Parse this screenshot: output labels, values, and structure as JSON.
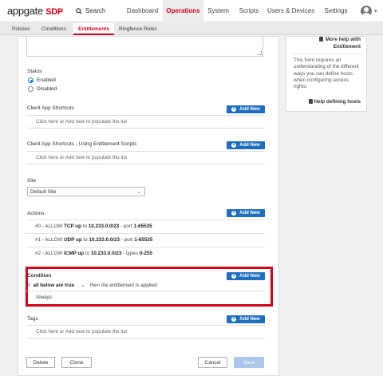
{
  "brand": {
    "part1": "appgate",
    "part2": "SDP"
  },
  "search": {
    "label": "Search"
  },
  "nav": [
    {
      "label": "Dashboard",
      "active": false
    },
    {
      "label": "Operations",
      "active": true
    },
    {
      "label": "System",
      "active": false
    },
    {
      "label": "Scripts",
      "active": false
    },
    {
      "label": "Users & Devices",
      "active": false
    },
    {
      "label": "Settings",
      "active": false
    }
  ],
  "subtabs": [
    {
      "label": "Policies",
      "active": false
    },
    {
      "label": "Conditions",
      "active": false
    },
    {
      "label": "Entitlements",
      "active": true
    },
    {
      "label": "Ringfence Rules",
      "active": false
    }
  ],
  "form": {
    "status": {
      "label": "Status",
      "options": [
        {
          "label": "Enabled",
          "selected": true
        },
        {
          "label": "Disabled",
          "selected": false
        }
      ]
    },
    "add_new_label": "Add New",
    "client_app_shortcuts": {
      "label": "Client App Shortcuts",
      "placeholder": "Click here or Add new to populate the list"
    },
    "client_app_shortcuts_scripts": {
      "label": "Client App Shortcuts - Using Entitlement Scripts",
      "placeholder": "Click here or Add new to populate the list"
    },
    "site": {
      "label": "Site",
      "value": "Default Site"
    },
    "actions": {
      "label": "Actions",
      "rows": [
        {
          "prefix": "#0 - ALLOW",
          "proto": "TCP up",
          "to": "to",
          "net": "10.233.0.0/23",
          "suffix": "- port",
          "ports": "1-65535"
        },
        {
          "prefix": "#1 - ALLOW",
          "proto": "UDP up",
          "to": "to",
          "net": "10.233.0.0/23",
          "suffix": "- port",
          "ports": "1-65535"
        },
        {
          "prefix": "#2 - ALLOW",
          "proto": "ICMP up",
          "to": "to",
          "net": "10.233.0.0/23",
          "suffix": "- types",
          "ports": "0-255"
        }
      ]
    },
    "condition": {
      "label": "Condition",
      "if_text": "If",
      "logic": "all below are true",
      "then_text": "then the entitlement is applied:",
      "items": [
        "Always"
      ]
    },
    "tags": {
      "label": "Tags",
      "placeholder": "Click here or Add new to populate the list"
    },
    "buttons": {
      "delete": "Delete",
      "clone": "Clone",
      "cancel": "Cancel",
      "save": "Save"
    }
  },
  "help": {
    "more_help_line1": "More help with",
    "more_help_line2": "Entitlement",
    "body": "This form requires an understanding of the different ways you can define hosts when configuring access rights.",
    "defining_hosts": "Help defining hosts"
  },
  "colors": {
    "accent_red": "#d0021b",
    "primary_blue": "#1f6fbf",
    "save_disabled": "#a9c8ea"
  }
}
